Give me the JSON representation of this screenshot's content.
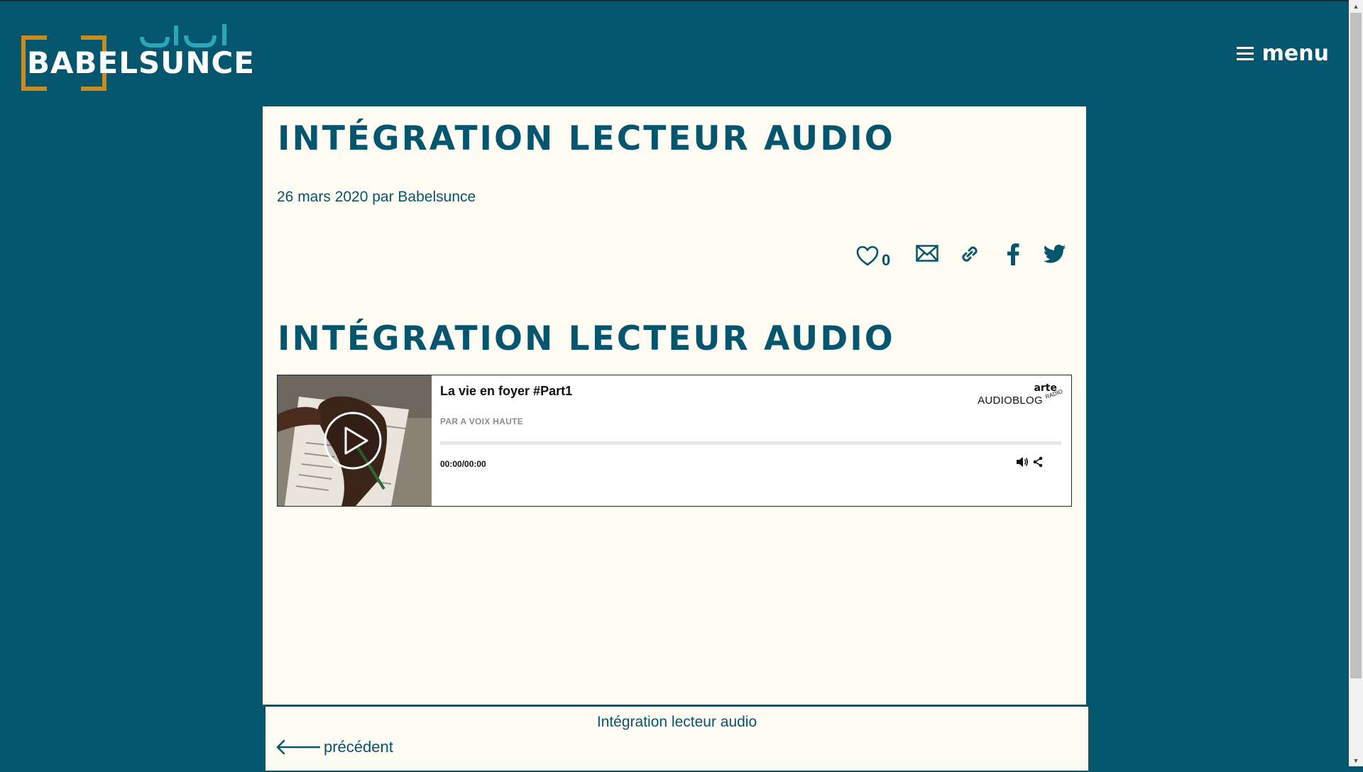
{
  "site": {
    "logo_text": "BABELSUNCE",
    "menu_label": "menu"
  },
  "article": {
    "title": "INTÉGRATION LECTEUR AUDIO",
    "date_author": "26 mars 2020 par Babelsunce",
    "like_count": "0",
    "section_title": "INTÉGRATION LECTEUR AUDIO"
  },
  "player": {
    "title": "La vie en foyer #Part1",
    "author": "PAR A VOIX HAUTE",
    "time": "00:00/00:00",
    "brand_top": "arte",
    "brand_small": "RADIO",
    "brand_name": "AUDIOBLOG",
    "progress": 0
  },
  "bottom_nav": {
    "current_title": "Intégration lecteur audio",
    "prev_label": "précédent"
  },
  "colors": {
    "background": "#04566f",
    "card": "#fffcf3",
    "accent_orange": "#c98a1e",
    "logo_script": "#2ba8b8"
  },
  "icons": [
    "menu-icon",
    "heart-icon",
    "mail-icon",
    "link-icon",
    "facebook-icon",
    "twitter-icon",
    "play-icon",
    "volume-icon",
    "share-icon",
    "arrow-left-icon"
  ]
}
